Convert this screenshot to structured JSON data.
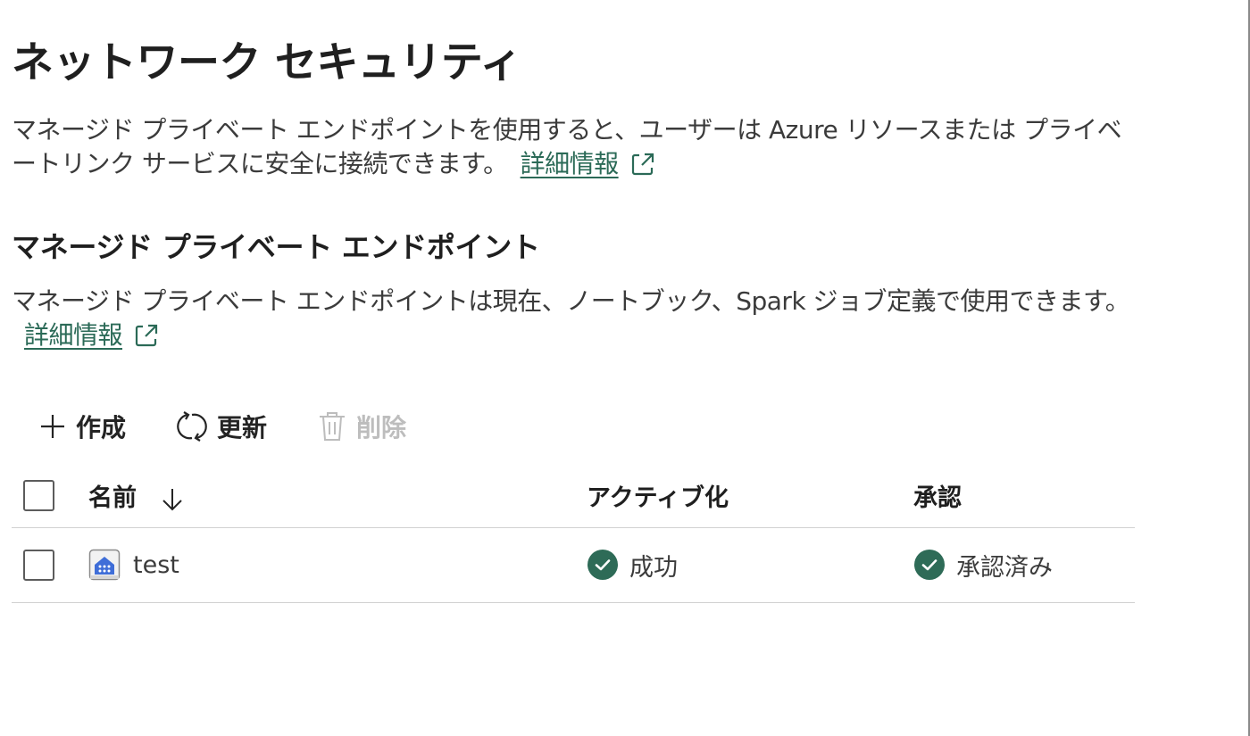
{
  "header": {
    "title": "ネットワーク セキュリティ",
    "description": "マネージド プライベート エンドポイントを使用すると、ユーザーは Azure リソースまたは プライベートリンク サービスに安全に接続できます。",
    "learn_more": "詳細情報"
  },
  "section": {
    "title": "マネージド プライベート エンドポイント",
    "description": "マネージド プライベート エンドポイントは現在、ノートブック、Spark ジョブ定義で使用できます。",
    "learn_more": "詳細情報"
  },
  "toolbar": {
    "create_label": "作成",
    "refresh_label": "更新",
    "delete_label": "削除"
  },
  "table": {
    "columns": {
      "name": "名前",
      "activation": "アクティブ化",
      "approval": "承認"
    },
    "rows": [
      {
        "name": "test",
        "activation": "成功",
        "approval": "承認済み"
      }
    ]
  },
  "colors": {
    "link": "#2b6a57",
    "success": "#2e6b57",
    "disabled": "#bdbdbd"
  },
  "icons": {
    "external_link": "external-link-icon",
    "create": "plus-icon",
    "refresh": "refresh-icon",
    "delete": "trash-icon",
    "sort": "arrow-down-icon",
    "endpoint": "private-endpoint-icon",
    "status": "check-circle-icon"
  }
}
